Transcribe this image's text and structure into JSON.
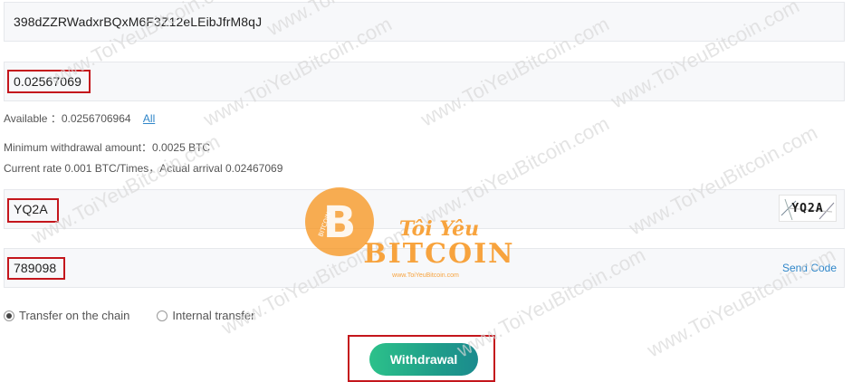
{
  "address": {
    "value": "398dZZRWadxrBQxM6F3Z12eLEibJfrM8qJ"
  },
  "amount": {
    "value": "0.02567069"
  },
  "available": {
    "label": "Available ：0.0256706964",
    "all_link": "All"
  },
  "minimum": "Minimum withdrawal amount：0.0025 BTC",
  "rate": "Current rate 0.001 BTC/Times，Actual arrival 0.02467069",
  "captcha": {
    "value": "YQ2A",
    "image_text": "YQ2A"
  },
  "sms_code": {
    "value": "789098",
    "send_label": "Send Code"
  },
  "transfer": {
    "options": [
      "Transfer on the chain",
      "Internal transfer"
    ],
    "selected": "Transfer on the chain"
  },
  "withdraw_button": "Withdrawal",
  "watermark": {
    "text": "www.ToiYeuBitcoin.com",
    "logo_lines": [
      "BITCOIN",
      "Tôi Yêu",
      "BITCOIN",
      "www.ToiYeuBitcoin.com"
    ]
  },
  "colors": {
    "highlight": "#c4161c",
    "link": "#2f86c9",
    "button_start": "#2cc18a",
    "button_end": "#1b8b8e",
    "watermark": "#f7941d"
  }
}
